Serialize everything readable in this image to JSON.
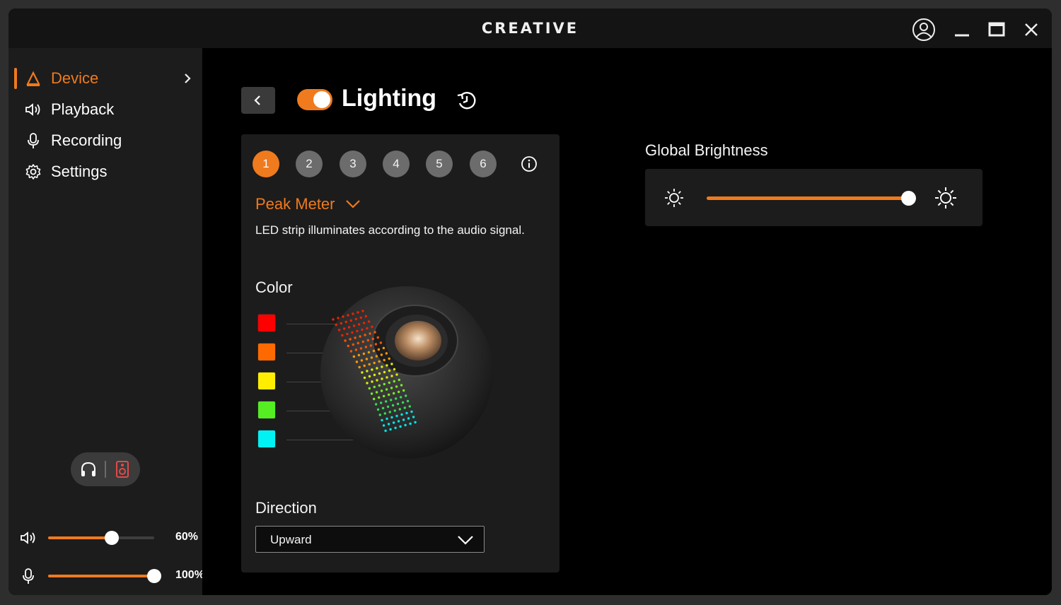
{
  "titlebar": {
    "brand": "CREATIVE",
    "icons": {
      "account": "user-circle-icon",
      "minimize": "minimize-icon",
      "maximize": "maximize-icon",
      "close": "close-icon"
    }
  },
  "sidebar": {
    "items": [
      {
        "label": "Device",
        "icon": "device-triangle-icon",
        "active": true
      },
      {
        "label": "Playback",
        "icon": "speaker-icon",
        "active": false
      },
      {
        "label": "Recording",
        "icon": "microphone-icon",
        "active": false
      },
      {
        "label": "Settings",
        "icon": "gear-icon",
        "active": false
      }
    ],
    "output_toggle": {
      "options": [
        "headphones-icon",
        "speaker-device-icon"
      ],
      "selected": "speaker-device-icon"
    },
    "volume": {
      "label": "60%",
      "level": 0.6,
      "icon": "speaker-volume-icon"
    },
    "mic": {
      "label": "100%",
      "level": 1.0,
      "icon": "microphone-icon"
    }
  },
  "main": {
    "title": "Lighting",
    "enabled": true,
    "presets": [
      "1",
      "2",
      "3",
      "4",
      "5",
      "6"
    ],
    "active_preset": "1",
    "mode": "Peak Meter",
    "description": "LED strip illuminates according to the audio signal.",
    "color_heading": "Color",
    "colors": [
      "#ff0000",
      "#ff6a00",
      "#ffee00",
      "#55ee22",
      "#00f2f2"
    ],
    "direction_heading": "Direction",
    "direction_value": "Upward",
    "global_brightness": {
      "title": "Global Brightness",
      "level": 0.98
    }
  },
  "colors": {
    "accent": "#f07a1e",
    "panel": "#1c1c1c",
    "background": "#000000"
  }
}
